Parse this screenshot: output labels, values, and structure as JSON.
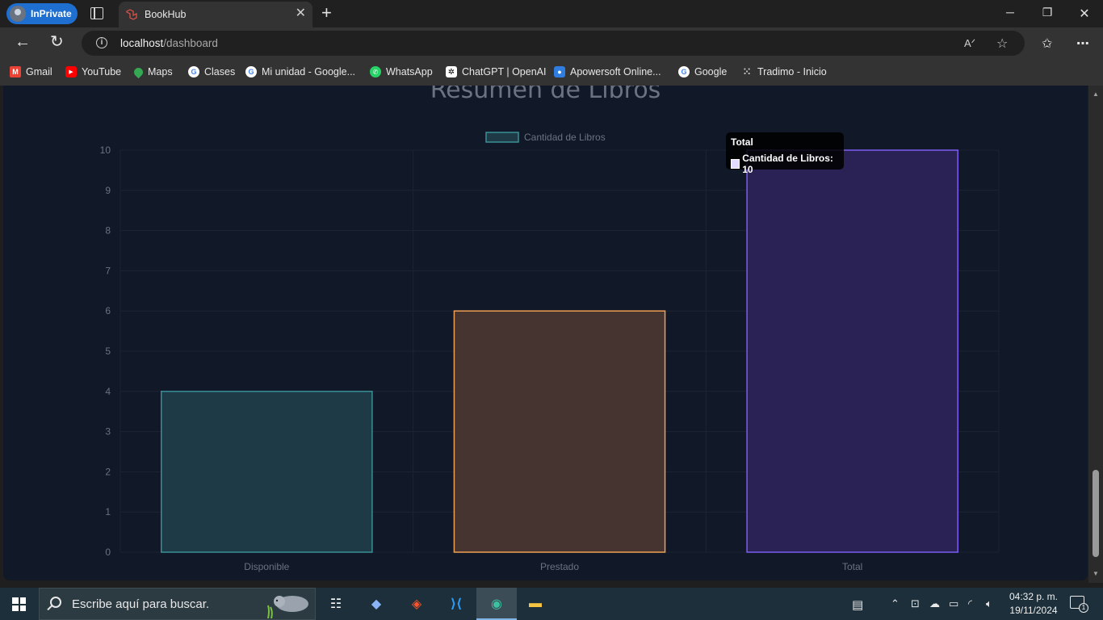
{
  "browser": {
    "inprivate_label": "InPrivate",
    "tab_title": "BookHub",
    "url_host": "localhost",
    "url_path": "/dashboard"
  },
  "favorites": [
    {
      "label": "Gmail",
      "icon": "gmail-icon",
      "color": "#ea4335"
    },
    {
      "label": "YouTube",
      "icon": "youtube-icon",
      "color": "#ff0000"
    },
    {
      "label": "Maps",
      "icon": "maps-icon",
      "color": "#34a853"
    },
    {
      "label": "Clases",
      "icon": "google-icon",
      "color": "#ffffff"
    },
    {
      "label": "Mi unidad - Google...",
      "icon": "google-icon",
      "color": "#ffffff"
    },
    {
      "label": "WhatsApp",
      "icon": "whatsapp-icon",
      "color": "#25d366"
    },
    {
      "label": "ChatGPT | OpenAI",
      "icon": "openai-icon",
      "color": "#ffffff"
    },
    {
      "label": "Apowersoft Online...",
      "icon": "apowersoft-icon",
      "color": "#2f7de1"
    },
    {
      "label": "Google",
      "icon": "google-icon",
      "color": "#ffffff"
    },
    {
      "label": "Tradimo - Inicio",
      "icon": "tradimo-icon",
      "color": "#cccccc"
    }
  ],
  "page": {
    "heading": "Resumen de Libros"
  },
  "chart_data": {
    "type": "bar",
    "categories": [
      "Disponible",
      "Prestado",
      "Total"
    ],
    "series": [
      {
        "name": "Cantidad de Libros",
        "values": [
          4,
          6,
          10
        ]
      }
    ],
    "bar_fill_colors": [
      "#1e3a46",
      "#45342f",
      "#2a2254"
    ],
    "bar_border_colors": [
      "#3a8f96",
      "#f0a054",
      "#7c5cf0"
    ],
    "ylim": [
      0,
      10
    ],
    "yticks": [
      0,
      1,
      2,
      3,
      4,
      5,
      6,
      7,
      8,
      9,
      10
    ],
    "grid": true,
    "legend_position": "top"
  },
  "tooltip": {
    "title": "Total",
    "text": "Cantidad de Libros: 10"
  },
  "taskbar": {
    "search_placeholder": "Escribe aquí para buscar.",
    "time": "04:32 p. m.",
    "date": "19/11/2024",
    "notification_count": "1"
  }
}
